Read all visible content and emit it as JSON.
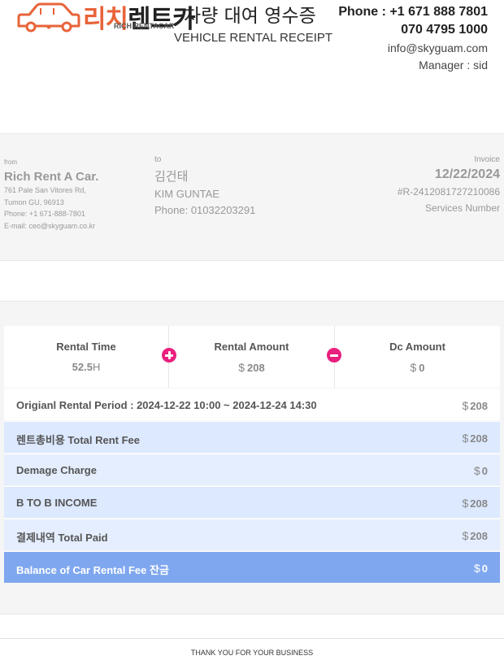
{
  "header": {
    "logo": {
      "word_part1": "리치",
      "word_part2": "렌트카",
      "sub": "RICH RENTACAR",
      "icon": "car-icon"
    },
    "title_kr": "차량 대여 영수증",
    "title_en": "VEHICLE RENTAL RECEIPT",
    "phone_label": "Phone :",
    "phone1": "+1 671 888 7801",
    "phone2": "070 4795 1000",
    "email": "info@skyguam.com",
    "manager": "Manager : sid"
  },
  "from": {
    "label": "from",
    "name": "Rich Rent A Car.",
    "address1": "761 Pale San Vitores Rd,",
    "address2": "Tumon GU, 96913",
    "phone": "Phone: +1 671-888-7801",
    "email": "E-mail: ceo@skyguam.co.kr"
  },
  "to": {
    "label": "to",
    "korean_name": "김건태",
    "english_name": "KIM GUNTAE",
    "phone": "Phone: 01032203291"
  },
  "invoice": {
    "label": "Invoice",
    "date": "12/22/2024",
    "number": "#R-2412081727210086",
    "services_label": "Services Number"
  },
  "summary": {
    "rental_time": {
      "label": "Rental Time",
      "value": "52.5",
      "unit": "H"
    },
    "rental_amount": {
      "label": "Rental Amount",
      "currency": "$",
      "value": "208"
    },
    "dc_amount": {
      "label": "Dc Amount",
      "currency": "$",
      "value": "0"
    },
    "plus_icon": "plus-circle-icon",
    "minus_icon": "minus-circle-icon"
  },
  "rows": [
    {
      "label": "Origianl Rental Period : 2024-12-22 10:00 ~ 2024-12-24 14:30",
      "currency": "$",
      "amount": "208"
    },
    {
      "label": "렌트총비용 Total Rent Fee",
      "currency": "$",
      "amount": "208"
    },
    {
      "label": "Demage Charge",
      "currency": "$",
      "amount": "0"
    },
    {
      "label": "B TO B INCOME",
      "currency": "$",
      "amount": "208"
    },
    {
      "label": "결제내역 Total Paid",
      "currency": "$",
      "amount": "208"
    },
    {
      "label": "Balance of Car Rental Fee 잔금",
      "currency": "$",
      "amount": "0"
    }
  ],
  "colors": {
    "accent": "#e9207f",
    "logo_orange": "#e8643a",
    "balance_row": "#7fa7ef",
    "row_light_blue": "#dce9ff"
  },
  "footer": "THANK YOU FOR YOUR BUSINESS"
}
